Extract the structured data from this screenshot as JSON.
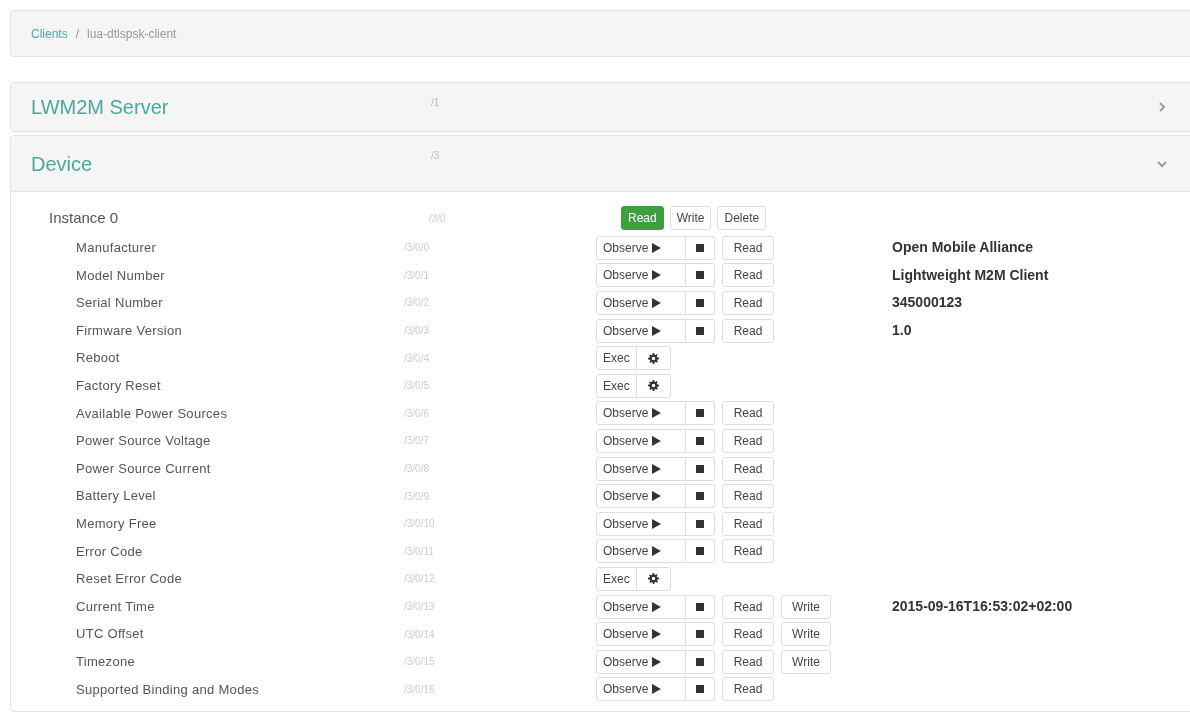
{
  "breadcrumb": [
    {
      "label": "Clients",
      "kind": "link"
    },
    {
      "label": "/",
      "kind": "separator"
    },
    {
      "label": "lua-dtlspsk-client",
      "kind": "current"
    }
  ],
  "panels": [
    {
      "title": "LWM2M Server",
      "path": "/1",
      "expanded": false
    },
    {
      "title": "Device",
      "path": "/3",
      "expanded": true,
      "instance": {
        "name": "Instance 0",
        "path": "/3/0",
        "actions": [
          {
            "label": "Read",
            "primary": true
          },
          {
            "label": "Write",
            "primary": false
          },
          {
            "label": "Delete",
            "primary": false
          }
        ],
        "resources": [
          {
            "name": "Manufacturer",
            "path": "/3/0/0",
            "kind": "observe",
            "observe_label": "Observe",
            "read_label": "Read",
            "value": "Open Mobile Alliance"
          },
          {
            "name": "Model Number",
            "path": "/3/0/1",
            "kind": "observe",
            "observe_label": "Observe",
            "read_label": "Read",
            "value": "Lightweight M2M Client"
          },
          {
            "name": "Serial Number",
            "path": "/3/0/2",
            "kind": "observe",
            "observe_label": "Observe",
            "read_label": "Read",
            "value": "345000123"
          },
          {
            "name": "Firmware Version",
            "path": "/3/0/3",
            "kind": "observe",
            "observe_label": "Observe",
            "read_label": "Read",
            "value": "1.0"
          },
          {
            "name": "Reboot",
            "path": "/3/0/4",
            "kind": "exec",
            "exec_label": "Exec"
          },
          {
            "name": "Factory Reset",
            "path": "/3/0/5",
            "kind": "exec",
            "exec_label": "Exec"
          },
          {
            "name": "Available Power Sources",
            "path": "/3/0/6",
            "kind": "observe",
            "observe_label": "Observe",
            "read_label": "Read"
          },
          {
            "name": "Power Source Voltage",
            "path": "/3/0/7",
            "kind": "observe",
            "observe_label": "Observe",
            "read_label": "Read"
          },
          {
            "name": "Power Source Current",
            "path": "/3/0/8",
            "kind": "observe",
            "observe_label": "Observe",
            "read_label": "Read"
          },
          {
            "name": "Battery Level",
            "path": "/3/0/9",
            "kind": "observe",
            "observe_label": "Observe",
            "read_label": "Read"
          },
          {
            "name": "Memory Free",
            "path": "/3/0/10",
            "kind": "observe",
            "observe_label": "Observe",
            "read_label": "Read"
          },
          {
            "name": "Error Code",
            "path": "/3/0/11",
            "kind": "observe",
            "observe_label": "Observe",
            "read_label": "Read"
          },
          {
            "name": "Reset Error Code",
            "path": "/3/0/12",
            "kind": "exec",
            "exec_label": "Exec"
          },
          {
            "name": "Current Time",
            "path": "/3/0/13",
            "kind": "observe",
            "observe_label": "Observe",
            "read_label": "Read",
            "write_label": "Write",
            "value": "2015-09-16T16:53:02+02:00"
          },
          {
            "name": "UTC Offset",
            "path": "/3/0/14",
            "kind": "observe",
            "observe_label": "Observe",
            "read_label": "Read",
            "write_label": "Write"
          },
          {
            "name": "Timezone",
            "path": "/3/0/15",
            "kind": "observe",
            "observe_label": "Observe",
            "read_label": "Read",
            "write_label": "Write"
          },
          {
            "name": "Supported Binding and Modes",
            "path": "/3/0/16",
            "kind": "observe",
            "observe_label": "Observe",
            "read_label": "Read"
          }
        ]
      }
    }
  ]
}
